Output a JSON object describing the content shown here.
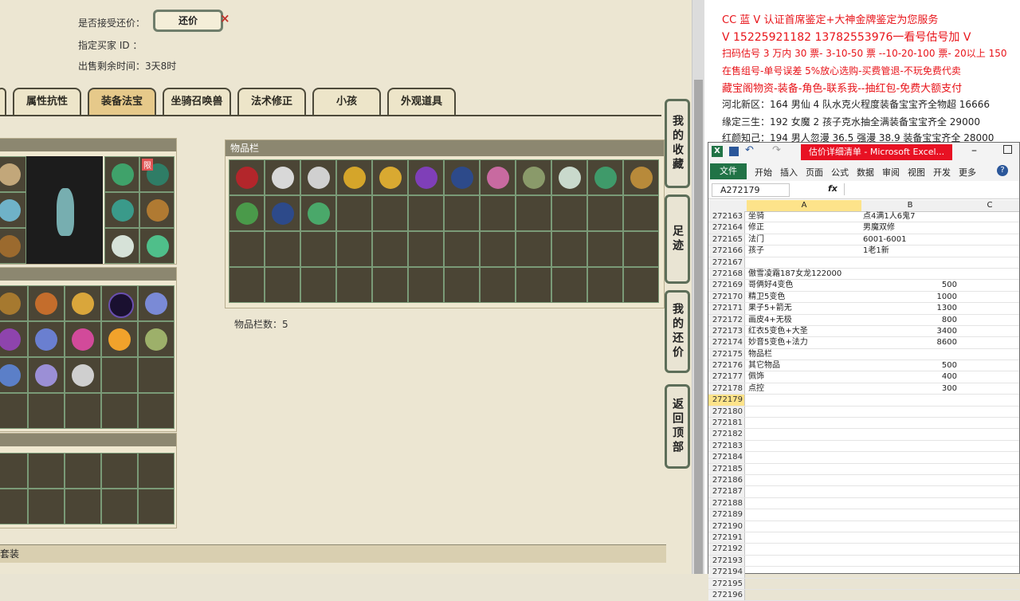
{
  "trade_info": {
    "accept_counter_label": "是否接受还价：",
    "counter_button": "还价",
    "close_mark": "×",
    "designated_buyer_label": "指定买家 ID ：",
    "remaining_time_label": "出售剩余时间：",
    "remaining_time_value": "3天8时"
  },
  "tabs": [
    {
      "label": "属性抗性"
    },
    {
      "label": "装备法宝"
    },
    {
      "label": "坐骑召唤兽"
    },
    {
      "label": "法术修正"
    },
    {
      "label": "小孩"
    },
    {
      "label": "外观道具"
    }
  ],
  "inventory": {
    "title": "物品栏",
    "count_text": "物品栏数：5"
  },
  "side_nav": [
    "我的收藏",
    "足迹",
    "我的还价",
    "返回顶部"
  ],
  "equip_badge": "限",
  "bottom_label": "套装",
  "right_text": {
    "lines": [
      "CC 蓝 V 认证首席鉴定+大神金牌鉴定为您服务",
      "V 15225921182     13782553976一看号估号加 V",
      "扫码估号 3 万内 30 票- 3-10-50 票 --10-20-100 票- 20以上 150",
      "在售组号-单号误差 5%放心选购-买费管退-不玩免费代卖",
      "藏宝阁物资-装备-角色-联系我--抽红包-免费大额支付",
      "河北新区：164 男仙 4 队水克火程度装备宝宝齐全物超 16666",
      "缘定三生：192 女魔 2 孩子克水抽全满装备宝宝齐全 29000",
      "红颜知己：194 男人忽漫 36.5 强漫 38.9 装备宝宝齐全 28000"
    ]
  },
  "excel": {
    "window_title": "估价详细清单 - Microsoft Excel...",
    "ribbon_tabs": [
      "文件",
      "开始",
      "插入",
      "页面",
      "公式",
      "数据",
      "审阅",
      "视图",
      "开发",
      "更多"
    ],
    "name_box": "A272179",
    "columns": [
      "A",
      "B",
      "C"
    ],
    "rows": [
      {
        "n": "272163",
        "a": "坐骑",
        "b": "点4满1人6鬼7",
        "num": false
      },
      {
        "n": "272164",
        "a": "修正",
        "b": "男魔双修",
        "num": false
      },
      {
        "n": "272165",
        "a": "法门",
        "b": "6001-6001",
        "num": false
      },
      {
        "n": "272166",
        "a": "孩子",
        "b": "1老1新",
        "num": false
      },
      {
        "n": "272167",
        "a": "",
        "b": "",
        "num": false
      },
      {
        "n": "272168",
        "a": "傲雪凌霜187女龙122000",
        "b": "",
        "num": false
      },
      {
        "n": "272169",
        "a": "哥俩好4变色",
        "b": "500",
        "num": true
      },
      {
        "n": "272170",
        "a": "精卫5变色",
        "b": "1000",
        "num": true
      },
      {
        "n": "272171",
        "a": "果子5+箭无",
        "b": "1300",
        "num": true
      },
      {
        "n": "272172",
        "a": "画皮4+无极",
        "b": "800",
        "num": true
      },
      {
        "n": "272173",
        "a": "红衣5变色+大圣",
        "b": "3400",
        "num": true
      },
      {
        "n": "272174",
        "a": "妙音5变色+法力",
        "b": "8600",
        "num": true
      },
      {
        "n": "272175",
        "a": "物品栏",
        "b": "",
        "num": false
      },
      {
        "n": "272176",
        "a": "其它物品",
        "b": "500",
        "num": true
      },
      {
        "n": "272177",
        "a": "佩饰",
        "b": "400",
        "num": true
      },
      {
        "n": "272178",
        "a": "点控",
        "b": "300",
        "num": true
      },
      {
        "n": "272179",
        "a": "",
        "b": "",
        "num": false
      },
      {
        "n": "272180",
        "a": "",
        "b": "",
        "num": false
      },
      {
        "n": "272181",
        "a": "",
        "b": "",
        "num": false
      },
      {
        "n": "272182",
        "a": "",
        "b": "",
        "num": false
      },
      {
        "n": "272183",
        "a": "",
        "b": "",
        "num": false
      },
      {
        "n": "272184",
        "a": "",
        "b": "",
        "num": false
      },
      {
        "n": "272185",
        "a": "",
        "b": "",
        "num": false
      },
      {
        "n": "272186",
        "a": "",
        "b": "",
        "num": false
      },
      {
        "n": "272187",
        "a": "",
        "b": "",
        "num": false
      },
      {
        "n": "272188",
        "a": "",
        "b": "",
        "num": false
      },
      {
        "n": "272189",
        "a": "",
        "b": "",
        "num": false
      },
      {
        "n": "272190",
        "a": "",
        "b": "",
        "num": false
      },
      {
        "n": "272191",
        "a": "",
        "b": "",
        "num": false
      },
      {
        "n": "272192",
        "a": "",
        "b": "",
        "num": false
      },
      {
        "n": "272193",
        "a": "",
        "b": "",
        "num": false
      },
      {
        "n": "272194",
        "a": "",
        "b": "",
        "num": false
      },
      {
        "n": "272195",
        "a": "",
        "b": "",
        "num": false
      },
      {
        "n": "272196",
        "a": "",
        "b": "",
        "num": false
      }
    ]
  },
  "colors": {
    "accent_red": "#e8141a",
    "excel_green": "#217346",
    "grid_cell": "#4b4535",
    "panel_head": "#8c8770"
  }
}
